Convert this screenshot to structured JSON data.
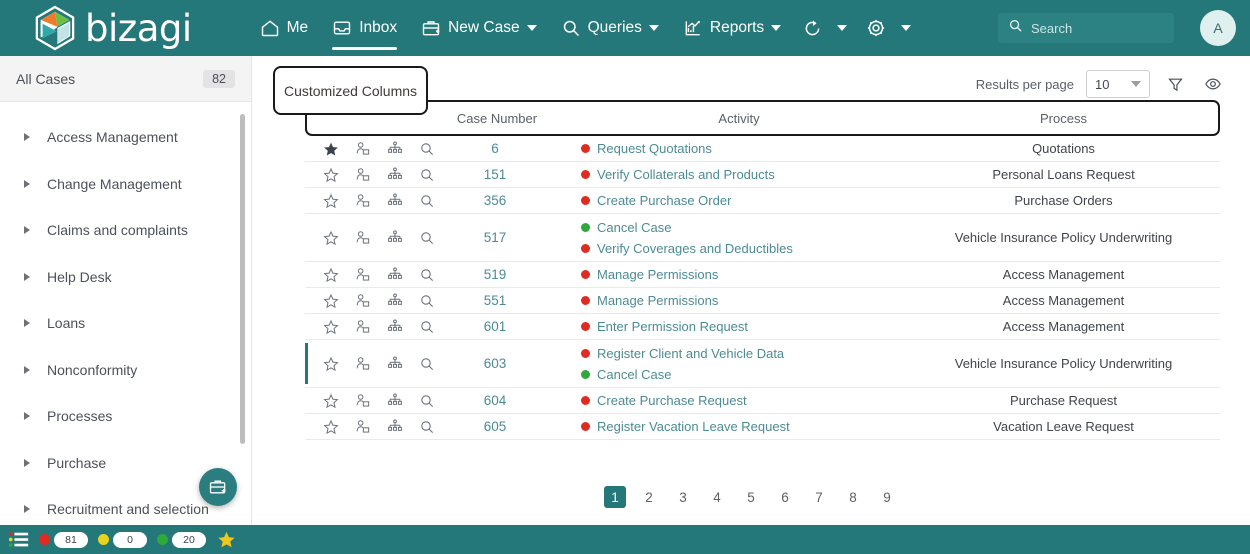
{
  "brand": {
    "name": "bizagi",
    "accent": "#24787a"
  },
  "topnav": {
    "items": [
      {
        "label": "Me",
        "icon": "home-icon",
        "caret": false,
        "active": false
      },
      {
        "label": "Inbox",
        "icon": "inbox-icon",
        "caret": false,
        "active": true
      },
      {
        "label": "New Case",
        "icon": "new-case-icon",
        "caret": true,
        "active": false
      },
      {
        "label": "Queries",
        "icon": "search-icon",
        "caret": true,
        "active": false
      },
      {
        "label": "Reports",
        "icon": "chart-icon",
        "caret": true,
        "active": false
      }
    ],
    "icon_only": [
      {
        "icon": "refresh-icon",
        "caret": true
      },
      {
        "icon": "gear-icon",
        "caret": true
      }
    ],
    "search_placeholder": "Search",
    "avatar_initial": "A"
  },
  "sidebar": {
    "all_cases_label": "All Cases",
    "all_cases_count": "82",
    "items": [
      {
        "label": "Access Management"
      },
      {
        "label": "Change Management"
      },
      {
        "label": "Claims and complaints"
      },
      {
        "label": "Help Desk"
      },
      {
        "label": "Loans"
      },
      {
        "label": "Nonconformity"
      },
      {
        "label": "Processes"
      },
      {
        "label": "Purchase"
      },
      {
        "label": "Recruitment and selection"
      }
    ],
    "fab_icon": "new-case-icon"
  },
  "callout": {
    "text": "Customized Columns"
  },
  "toolbar": {
    "results_per_page_label": "Results per page",
    "results_per_page_value": "10",
    "filter_icon": "filter-icon",
    "visibility_icon": "eye-icon"
  },
  "table": {
    "columns": [
      "",
      "Case Number",
      "Activity",
      "Process"
    ],
    "rows": [
      {
        "favorite": true,
        "marked": false,
        "case_number": "6",
        "activities": [
          {
            "text": "Request Quotations",
            "status": "#e02b20"
          }
        ],
        "process": "Quotations"
      },
      {
        "favorite": false,
        "marked": false,
        "case_number": "151",
        "activities": [
          {
            "text": "Verify Collaterals and Products",
            "status": "#e02b20"
          }
        ],
        "process": "Personal Loans Request"
      },
      {
        "favorite": false,
        "marked": false,
        "case_number": "356",
        "activities": [
          {
            "text": "Create Purchase Order",
            "status": "#e02b20"
          }
        ],
        "process": "Purchase Orders"
      },
      {
        "favorite": false,
        "marked": false,
        "case_number": "517",
        "activities": [
          {
            "text": "Cancel Case",
            "status": "#2fa83c"
          },
          {
            "text": "Verify Coverages and Deductibles",
            "status": "#e02b20"
          }
        ],
        "process": "Vehicle Insurance Policy Underwriting"
      },
      {
        "favorite": false,
        "marked": false,
        "case_number": "519",
        "activities": [
          {
            "text": "Manage Permissions",
            "status": "#e02b20"
          }
        ],
        "process": "Access Management"
      },
      {
        "favorite": false,
        "marked": false,
        "case_number": "551",
        "activities": [
          {
            "text": "Manage Permissions",
            "status": "#e02b20"
          }
        ],
        "process": "Access Management"
      },
      {
        "favorite": false,
        "marked": false,
        "case_number": "601",
        "activities": [
          {
            "text": "Enter Permission Request",
            "status": "#e02b20"
          }
        ],
        "process": "Access Management"
      },
      {
        "favorite": false,
        "marked": true,
        "case_number": "603",
        "activities": [
          {
            "text": "Register Client and Vehicle Data",
            "status": "#e02b20"
          },
          {
            "text": "Cancel Case",
            "status": "#2fa83c"
          }
        ],
        "process": "Vehicle Insurance Policy Underwriting"
      },
      {
        "favorite": false,
        "marked": false,
        "case_number": "604",
        "activities": [
          {
            "text": "Create Purchase Request",
            "status": "#e02b20"
          }
        ],
        "process": "Purchase Request"
      },
      {
        "favorite": false,
        "marked": false,
        "case_number": "605",
        "activities": [
          {
            "text": "Register Vacation Leave Request",
            "status": "#e02b20"
          }
        ],
        "process": "Vacation Leave Request"
      }
    ],
    "row_icons": [
      "favorite-star-icon",
      "assign-user-icon",
      "workflow-icon",
      "magnifier-icon"
    ]
  },
  "pagination": {
    "pages": [
      "1",
      "2",
      "3",
      "4",
      "5",
      "6",
      "7",
      "8",
      "9"
    ],
    "current": "1"
  },
  "statusbar": {
    "menu_icon": "list-menu-icon",
    "counters": [
      {
        "color": "#e02b20",
        "value": "81"
      },
      {
        "color": "#e8d41a",
        "value": "0"
      },
      {
        "color": "#2fa83c",
        "value": "20"
      }
    ],
    "star_icon": "star-icon"
  }
}
